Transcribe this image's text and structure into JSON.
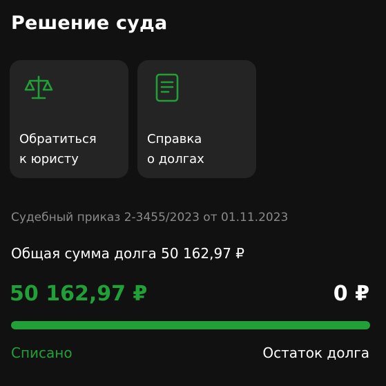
{
  "header": {
    "title": "Решение суда"
  },
  "cards": [
    {
      "icon": "scales-icon",
      "line1": "Обратиться",
      "line2": "к юристу"
    },
    {
      "icon": "document-icon",
      "line1": "Справка",
      "line2": "о долгах"
    }
  ],
  "court_order": {
    "text": "Судебный приказ 2-3455/2023 от 01.11.2023"
  },
  "debt": {
    "total_text": "Общая сумма долга 50 162,97 ₽",
    "paid_amount": "50 162,97 ₽",
    "remaining_amount": "0 ₽",
    "paid_label": "Списано",
    "remaining_label": "Остаток долга",
    "progress_fraction": 1.0
  },
  "colors": {
    "accent": "#21a038",
    "background": "#111111",
    "card": "#242424",
    "muted_text": "#8a8a8a"
  }
}
